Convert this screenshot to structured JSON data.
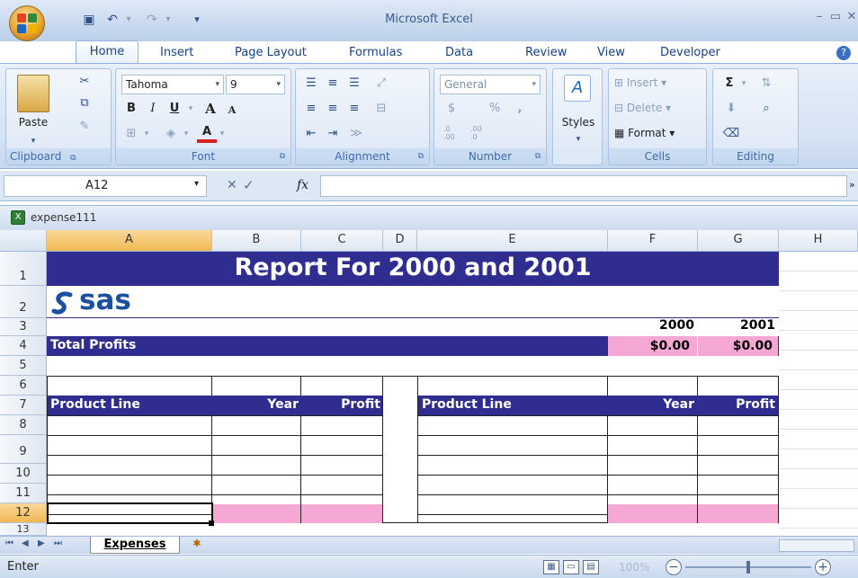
{
  "app": {
    "title": "Microsoft Excel"
  },
  "tabs": [
    "Home",
    "Insert",
    "Page Layout",
    "Formulas",
    "Data",
    "Review",
    "View",
    "Developer"
  ],
  "ribbon": {
    "clipboard": {
      "label": "Clipboard",
      "paste": "Paste"
    },
    "font": {
      "label": "Font",
      "name": "Tahoma",
      "size": "9",
      "bold": "B",
      "italic": "I",
      "underline": "U",
      "grow": "A",
      "shrink": "A",
      "color_glyph": "A"
    },
    "alignment": {
      "label": "Alignment"
    },
    "number": {
      "label": "Number",
      "format": "General",
      "currency": "$",
      "percent": "%",
      "comma": ",",
      "inc_dec": ".0\n.00",
      "dec_dec": ".00\n.0"
    },
    "styles": {
      "label": "Styles"
    },
    "cells": {
      "label": "Cells",
      "insert": "Insert",
      "delete": "Delete",
      "format": "Format"
    },
    "editing": {
      "label": "Editing",
      "sum": "Σ"
    }
  },
  "formula_bar": {
    "name_box": "A12",
    "cancel": "✕",
    "enter": "✓",
    "fx": "fx",
    "value": ""
  },
  "workbook": {
    "name": "expense111",
    "columns": [
      "A",
      "B",
      "C",
      "D",
      "E",
      "F",
      "G",
      "H"
    ],
    "rows": [
      "1",
      "2",
      "3",
      "4",
      "5",
      "6",
      "7",
      "8",
      "9",
      "10",
      "11",
      "12",
      "13"
    ],
    "selected_column": "A",
    "selected_row": "12"
  },
  "sheet": {
    "title": "Report For 2000 and 2001",
    "logo_text": "sas",
    "year1": "2000",
    "year2": "2001",
    "total_profits_label": "Total Profits",
    "total_2000": "$0.00",
    "total_2001": "$0.00",
    "left_headers": {
      "product_line": "Product Line",
      "year": "Year",
      "profit": "Profit"
    },
    "right_headers": {
      "product_line": "Product Line",
      "year": "Year",
      "profit": "Profit"
    }
  },
  "sheet_tabs": {
    "active": "Expenses"
  },
  "status": {
    "mode": "Enter",
    "zoom": "100%"
  },
  "colors": {
    "header_navy": "#2f2d8f",
    "highlight_pink": "#f6a8d4",
    "sas_blue": "#1b4fa0"
  }
}
